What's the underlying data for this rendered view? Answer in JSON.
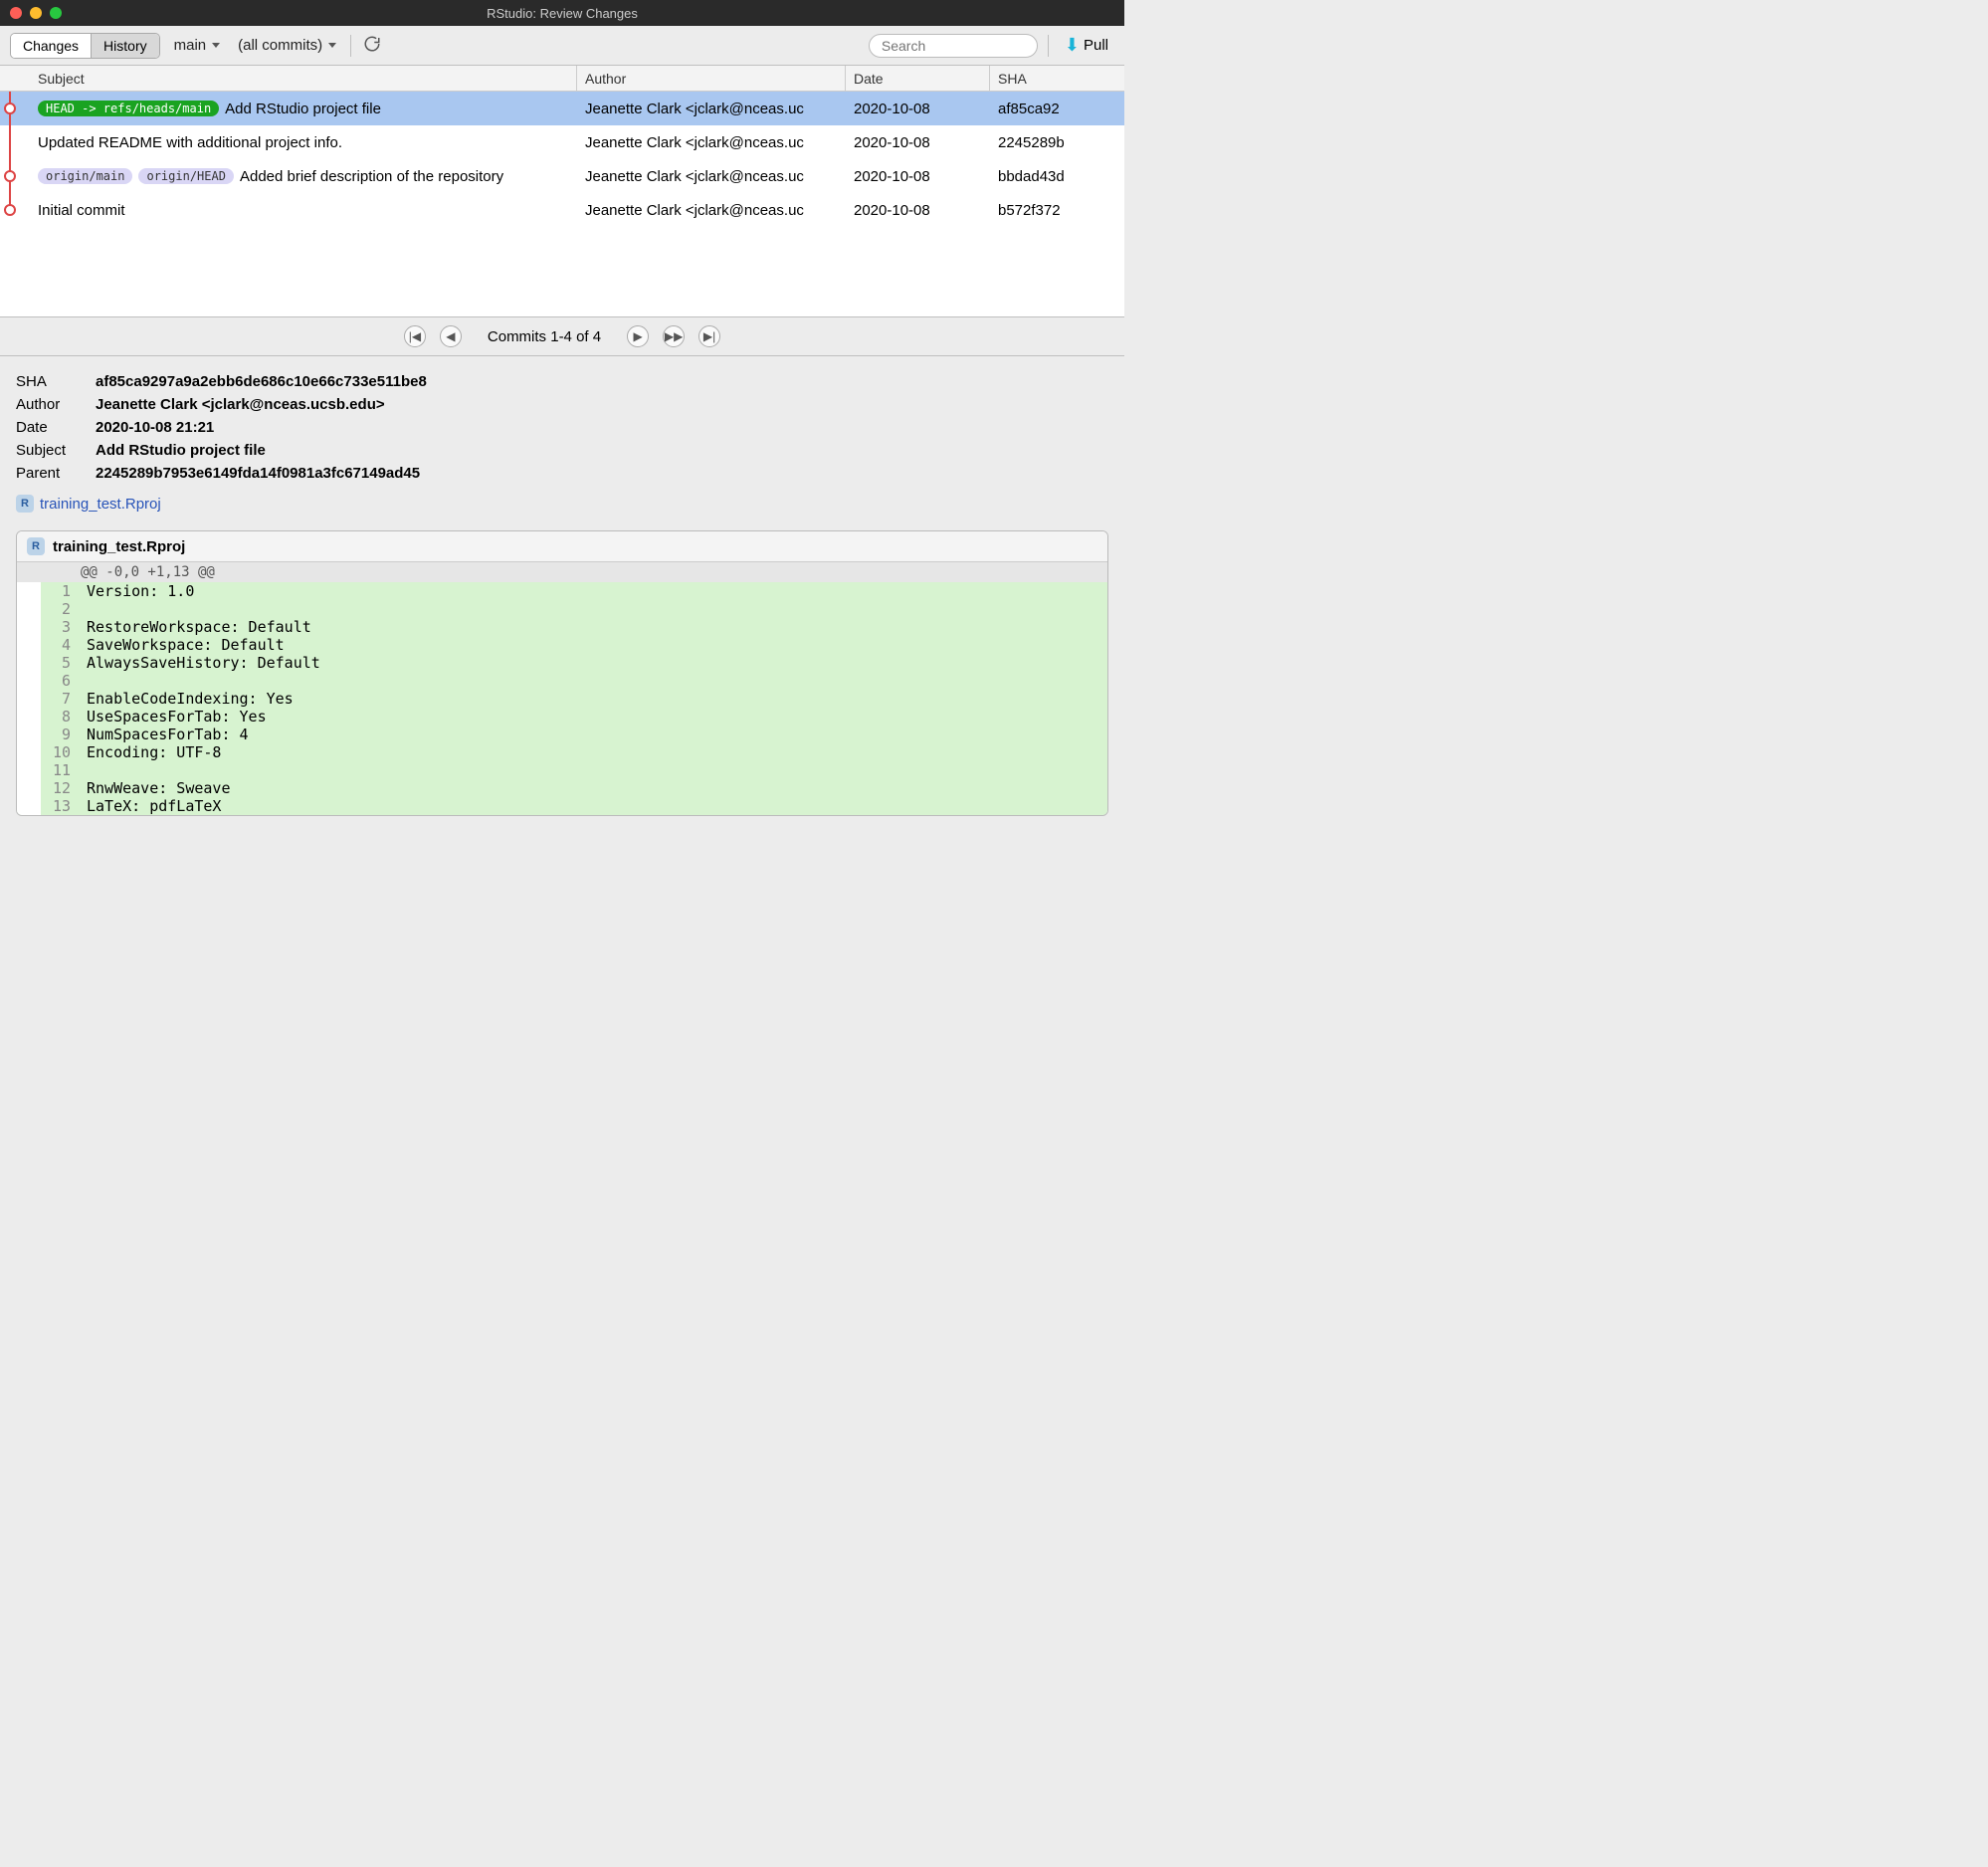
{
  "window_title": "RStudio: Review Changes",
  "toolbar": {
    "tabs": {
      "changes": "Changes",
      "history": "History",
      "active": "history"
    },
    "branch": "main",
    "filter": "(all commits)",
    "search_placeholder": "Search",
    "pull_label": "Pull"
  },
  "columns": {
    "subject": "Subject",
    "author": "Author",
    "date": "Date",
    "sha": "SHA"
  },
  "commits": [
    {
      "refs": [
        {
          "text": "HEAD -> refs/heads/main",
          "kind": "green"
        }
      ],
      "subject": "Add RStudio project file",
      "author": "Jeanette Clark <jclark@nceas.uc",
      "date": "2020-10-08",
      "sha": "af85ca92",
      "selected": true,
      "graph": "dot"
    },
    {
      "refs": [],
      "subject": "Updated README with additional project info.",
      "author": "Jeanette Clark <jclark@nceas.uc",
      "date": "2020-10-08",
      "sha": "2245289b",
      "selected": false,
      "graph": "line"
    },
    {
      "refs": [
        {
          "text": "origin/main",
          "kind": "lav"
        },
        {
          "text": "origin/HEAD",
          "kind": "lav"
        }
      ],
      "subject": "Added brief description of the repository",
      "author": "Jeanette Clark <jclark@nceas.uc",
      "date": "2020-10-08",
      "sha": "bbdad43d",
      "selected": false,
      "graph": "dot"
    },
    {
      "refs": [],
      "subject": "Initial commit",
      "author": "Jeanette Clark <jclark@nceas.uc",
      "date": "2020-10-08",
      "sha": "b572f372",
      "selected": false,
      "graph": "enddot"
    }
  ],
  "pager": {
    "status": "Commits 1-4 of 4"
  },
  "detail": {
    "labels": {
      "sha": "SHA",
      "author": "Author",
      "date": "Date",
      "subject": "Subject",
      "parent": "Parent"
    },
    "sha": "af85ca9297a9a2ebb6de686c10e66c733e511be8",
    "author": "Jeanette Clark <jclark@nceas.ucsb.edu>",
    "date": "2020-10-08 21:21",
    "subject": "Add RStudio project file",
    "parent": "2245289b7953e6149fda14f0981a3fc67149ad45",
    "file_link": "training_test.Rproj"
  },
  "diff": {
    "file": "training_test.Rproj",
    "hunk": "@@ -0,0 +1,13 @@",
    "lines": [
      {
        "n": 1,
        "text": "Version: 1.0"
      },
      {
        "n": 2,
        "text": ""
      },
      {
        "n": 3,
        "text": "RestoreWorkspace: Default"
      },
      {
        "n": 4,
        "text": "SaveWorkspace: Default"
      },
      {
        "n": 5,
        "text": "AlwaysSaveHistory: Default"
      },
      {
        "n": 6,
        "text": ""
      },
      {
        "n": 7,
        "text": "EnableCodeIndexing: Yes"
      },
      {
        "n": 8,
        "text": "UseSpacesForTab: Yes"
      },
      {
        "n": 9,
        "text": "NumSpacesForTab: 4"
      },
      {
        "n": 10,
        "text": "Encoding: UTF-8"
      },
      {
        "n": 11,
        "text": ""
      },
      {
        "n": 12,
        "text": "RnwWeave: Sweave"
      },
      {
        "n": 13,
        "text": "LaTeX: pdfLaTeX"
      }
    ]
  }
}
